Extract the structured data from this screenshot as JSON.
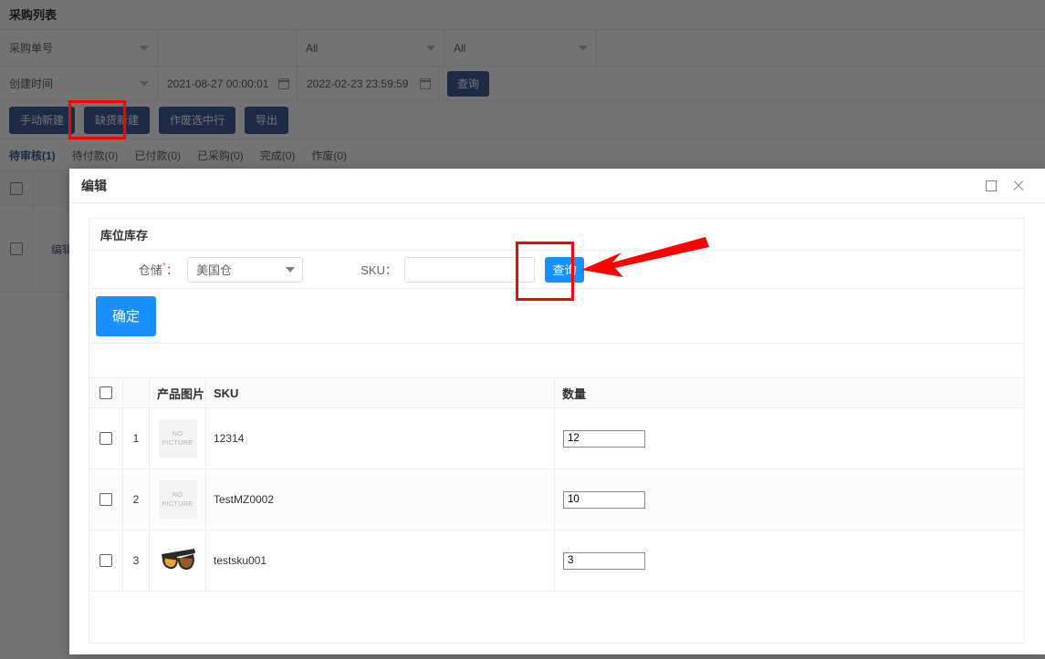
{
  "background": {
    "page_title": "采购列表",
    "filters": {
      "select_label": "采购单号",
      "text_value": "",
      "status_all_1": "All",
      "status_all_2": "All",
      "date_select_label": "创建时间",
      "date_from": "2021-08-27 00:00:01",
      "date_to": "2022-02-23 23:59:59",
      "search_label": "查询"
    },
    "actions": [
      {
        "label": "手动新建"
      },
      {
        "label": "缺货新建"
      },
      {
        "label": "作废选中行"
      },
      {
        "label": "导出"
      }
    ],
    "tabs": [
      {
        "label": "待审核(1)",
        "active": true
      },
      {
        "label": "待付款(0)",
        "active": false
      },
      {
        "label": "已付款(0)",
        "active": false
      },
      {
        "label": "已采购(0)",
        "active": false
      },
      {
        "label": "完成(0)",
        "active": false
      },
      {
        "label": "作废(0)",
        "active": false
      }
    ],
    "row_link": "编辑"
  },
  "modal": {
    "title": "编辑",
    "window_controls": {
      "maximize_icon": "maximize-icon",
      "close_icon": "close-icon"
    },
    "panel": {
      "heading": "库位库存",
      "form": {
        "warehouse_label": "仓储",
        "warehouse_required_mark": "*",
        "warehouse_colon": "：",
        "warehouse_value": "美国仓",
        "sku_label": "SKU：",
        "sku_value": "",
        "sku_placeholder": "",
        "query_button": "查询"
      },
      "confirm_button": "确定"
    },
    "table": {
      "columns": [
        "",
        "",
        "产品图片",
        "SKU",
        "数量"
      ],
      "rows": [
        {
          "index": "1",
          "image": "no-picture",
          "image_text_line1": "NO",
          "image_text_line2": "PICTURE",
          "sku": "12314",
          "qty": "12"
        },
        {
          "index": "2",
          "image": "no-picture",
          "image_text_line1": "NO",
          "image_text_line2": "PICTURE",
          "sku": "TestMZ0002",
          "qty": "10"
        },
        {
          "index": "3",
          "image": "sunglasses-thumbnail",
          "image_text_line1": "",
          "image_text_line2": "",
          "sku": "testsku001",
          "qty": "3"
        }
      ]
    }
  },
  "annotations": {
    "highlight_1": "缺货新建",
    "highlight_2": "查询",
    "arrow_color": "#ff0000",
    "box_color": "#ff0000"
  },
  "colors": {
    "primary_blue": "#1890ff",
    "dark_blue_button": "#41619b",
    "link_blue": "#3a5fa0",
    "annotation_red": "#ff0000",
    "overlay": "rgba(0,0,0,0.55)"
  }
}
